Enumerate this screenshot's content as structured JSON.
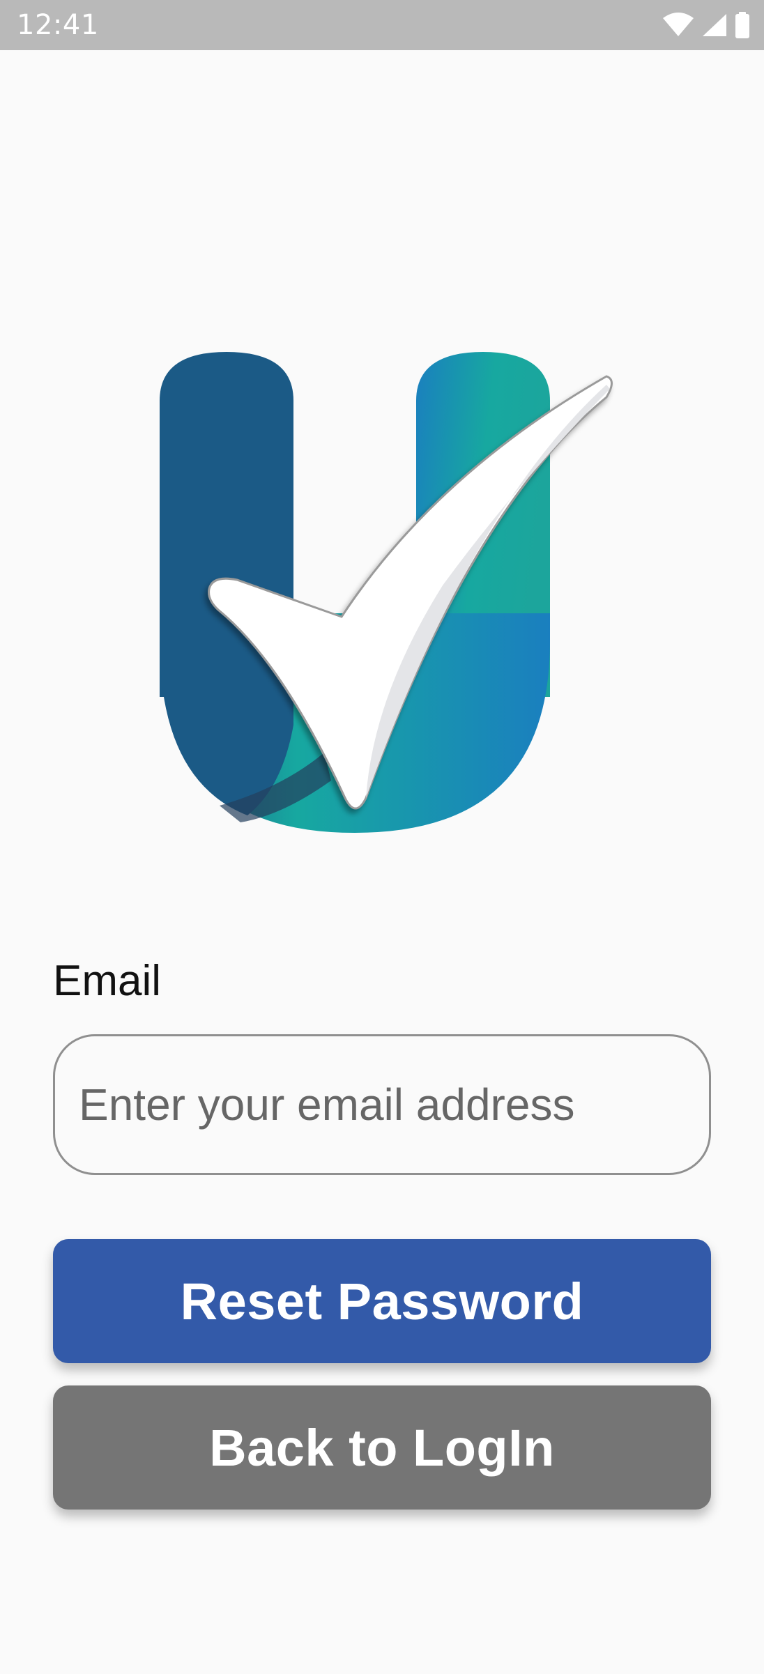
{
  "status_bar": {
    "time": "12:41",
    "icons": [
      "wifi-icon",
      "cell-signal-icon",
      "battery-icon"
    ]
  },
  "logo": {
    "icon": "check-logo-icon",
    "colors": {
      "navy": "#1b5a86",
      "blue": "#1a7fbf",
      "teal": "#17a8a0",
      "check": "#ffffff"
    }
  },
  "form": {
    "email_label": "Email",
    "email_placeholder": "Enter your email address",
    "email_value": "",
    "reset_button": "Reset Password",
    "back_button": "Back to LogIn"
  },
  "colors": {
    "status_bar": "#b9b9b9",
    "background": "#fafafa",
    "primary_button": "#335aa9",
    "secondary_button": "#757575",
    "input_border": "#8f8f8f"
  }
}
